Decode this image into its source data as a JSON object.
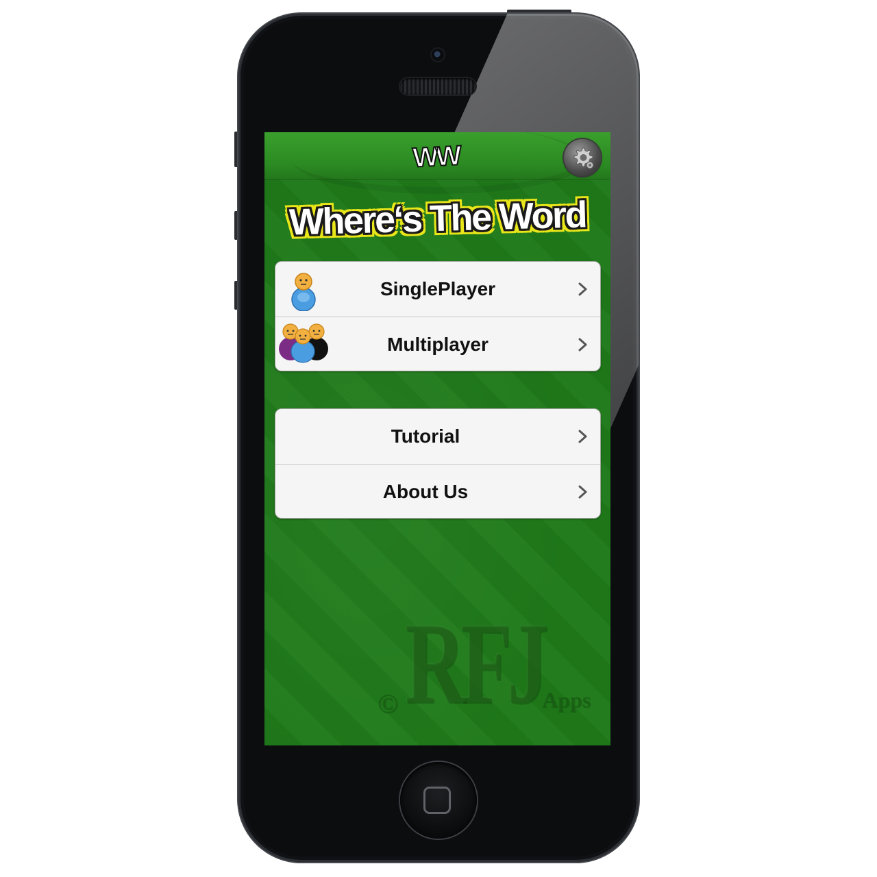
{
  "app": {
    "logo_text": "WW",
    "title": "Where‘s The Word"
  },
  "menu": {
    "primary": [
      {
        "label": "SinglePlayer",
        "icon": "single-player-icon"
      },
      {
        "label": "Multiplayer",
        "icon": "multiplayer-icon"
      }
    ],
    "secondary": [
      {
        "label": "Tutorial"
      },
      {
        "label": "About Us"
      }
    ]
  },
  "watermark": {
    "brand": "RFJ",
    "copyright": "©",
    "suffix": "Apps"
  },
  "icons": {
    "settings": "gear-icon",
    "chevron": "chevron-right-icon"
  },
  "colors": {
    "background_green": "#1f7a1a",
    "topbar_green": "#2f9426",
    "title_outline_yellow": "#e9e61a",
    "menu_background": "#f5f5f5",
    "single_player_blue": "#4a9de0",
    "multiplayer_purple": "#7b2c85",
    "multiplayer_black": "#111111"
  }
}
